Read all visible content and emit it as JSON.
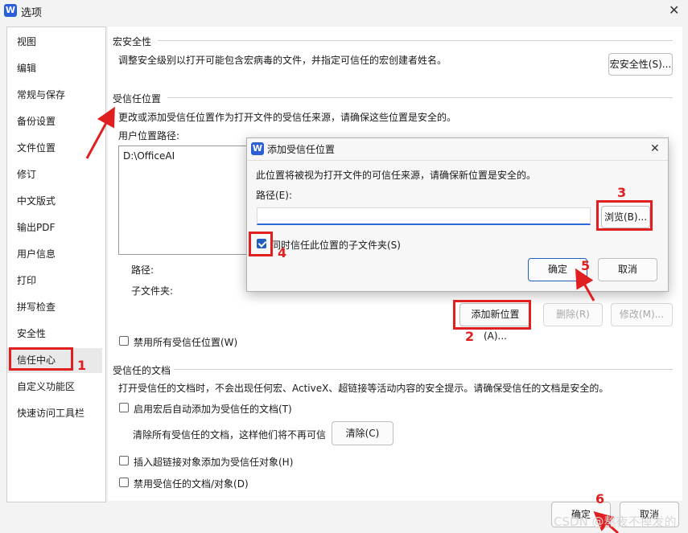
{
  "window": {
    "title": "选项",
    "logo": "W"
  },
  "sidebar": {
    "items": [
      {
        "label": "视图"
      },
      {
        "label": "编辑"
      },
      {
        "label": "常规与保存"
      },
      {
        "label": "备份设置"
      },
      {
        "label": "文件位置"
      },
      {
        "label": "修订"
      },
      {
        "label": "中文版式"
      },
      {
        "label": "输出PDF"
      },
      {
        "label": "用户信息"
      },
      {
        "label": "打印"
      },
      {
        "label": "拼写检查"
      },
      {
        "label": "安全性"
      },
      {
        "label": "信任中心"
      },
      {
        "label": "自定义功能区"
      },
      {
        "label": "快速访问工具栏"
      }
    ],
    "selected_index": 12
  },
  "macro": {
    "title": "宏安全性",
    "desc": "调整安全级别以打开可能包含宏病毒的文件，并指定可信任的宏创建者姓名。",
    "button": "宏安全性(S)..."
  },
  "trusted_locations": {
    "title": "受信任位置",
    "desc": "更改或添加受信任位置作为打开文件的受信任来源，请确保这些位置是安全的。",
    "list_label": "用户位置路径:",
    "list_items": [
      "D:\\OfficeAI"
    ],
    "path_label": "路径:",
    "subfolder_label": "子文件夹:",
    "add_button": "添加新位置(A)...",
    "delete_button": "删除(R)",
    "modify_button": "修改(M)...",
    "disable_all": "禁用所有受信任位置(W)"
  },
  "trusted_docs": {
    "title": "受信任的文档",
    "desc": "打开受信任的文档时，不会出现任何宏、ActiveX、超链接等活动内容的安全提示。请确保受信任的文档是安全的。",
    "auto_add": "启用宏后自动添加为受信任的文档(T)",
    "clear_text": "清除所有受信任的文档，这样他们将不再可信",
    "clear_button": "清除(C)",
    "insert_link": "插入超链接对象添加为受信任对象(H)",
    "disable_docs": "禁用受信任的文档/对象(D)"
  },
  "footer": {
    "ok": "确定",
    "cancel": "取消"
  },
  "dialog": {
    "title": "添加受信任位置",
    "logo": "W",
    "desc": "此位置将被视为打开文件的可信任来源，请确保新位置是安全的。",
    "path_label": "路径(E):",
    "path_value": "",
    "browse_button": "浏览(B)...",
    "subfolder_checkbox": "同时信任此位置的子文件夹(S)",
    "subfolder_checked": true,
    "ok": "确定",
    "cancel": "取消"
  },
  "annotations": {
    "n1": "1",
    "n2": "2",
    "n3": "3",
    "n4": "4",
    "n5": "5",
    "n6": "6"
  },
  "watermark": "CSDN @熬夜不掉发的",
  "colors": {
    "accent": "#1f5fbf",
    "annotation": "#e02020"
  }
}
